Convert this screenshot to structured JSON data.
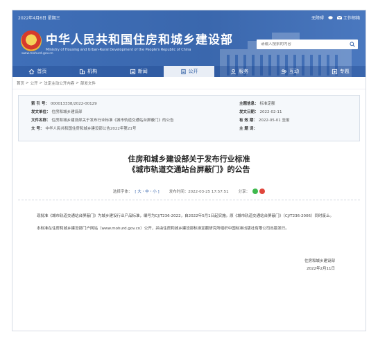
{
  "topbar": {
    "date": "2022年4月6日 星期三",
    "accessibility": "无障碍",
    "weibo": "",
    "mail": "工作邮箱"
  },
  "brand": {
    "cn_name": "中华人民共和国住房和城乡建设部",
    "en_name": "Ministry of Housing and Urban-Rural Development of the People's Republic of China",
    "url": "www.mohurd.gov.cn"
  },
  "search": {
    "placeholder": "请输入搜索的内容"
  },
  "nav": {
    "items": [
      {
        "label": "首页",
        "icon": "home-icon"
      },
      {
        "label": "机构",
        "icon": "building-icon"
      },
      {
        "label": "新闻",
        "icon": "news-icon"
      },
      {
        "label": "公开",
        "icon": "document-icon",
        "active": true
      },
      {
        "label": "服务",
        "icon": "service-icon"
      },
      {
        "label": "互动",
        "icon": "interaction-icon"
      },
      {
        "label": "专题",
        "icon": "topic-icon"
      }
    ]
  },
  "breadcrumb": {
    "items": [
      "首页",
      "公开",
      "法定主动公开内容",
      "部发文件"
    ],
    "separator": ">"
  },
  "meta": {
    "index_label": "索 引 号：",
    "index_value": "000013338/2022-00129",
    "category_label": "主题信息：",
    "category_value": "标准定额",
    "issuer_label": "发文单位：",
    "issuer_value": "住房和城乡建设部",
    "issue_date_label": "发文日期：",
    "issue_date_value": "2022-02-11",
    "name_label": "文件名称：",
    "name_value": "住房和城乡建设部关于发布行业标准《城市轨道交通站台屏蔽门》的公告",
    "validity_label": "有 效 期：",
    "validity_value": "2022-05-01 至废",
    "docno_label": "文    号：",
    "docno_value": "中华人民共和国住房和城乡建设部公告2022年第21号",
    "keyword_label": "主 题 词：",
    "keyword_value": ""
  },
  "article": {
    "title_line1": "住房和城乡建设部关于发布行业标准",
    "title_line2": "《城市轨道交通站台屏蔽门》的公告",
    "font_size_label": "选择字体：",
    "font_size_options": "[ 大・中・小 ]",
    "publish_time": "发布时间：2022-03-25 17:57:51",
    "share_label": "分享：",
    "paragraph1": "现批准《城市轨道交通站台屏蔽门》为城乡建设行业产品标准，编号为CJ/T236-2022，自2022年5月1日起实施。原《城市轨道交通站台屏蔽门》（CJ/T236-2006）同时废止。",
    "paragraph2": "本标准在住房和城乡建设部门户网站（www.mohurd.gov.cn）公开，并由住房和城乡建设部标准定额研究所组织中国标准出版社有限公司出版发行。",
    "sign_org": "住房和城乡建设部",
    "sign_date": "2022年2月11日"
  },
  "colors": {
    "header_blue": "#3a67ad",
    "share_wechat": "#3fb94e",
    "share_weibo": "#e0463c"
  }
}
